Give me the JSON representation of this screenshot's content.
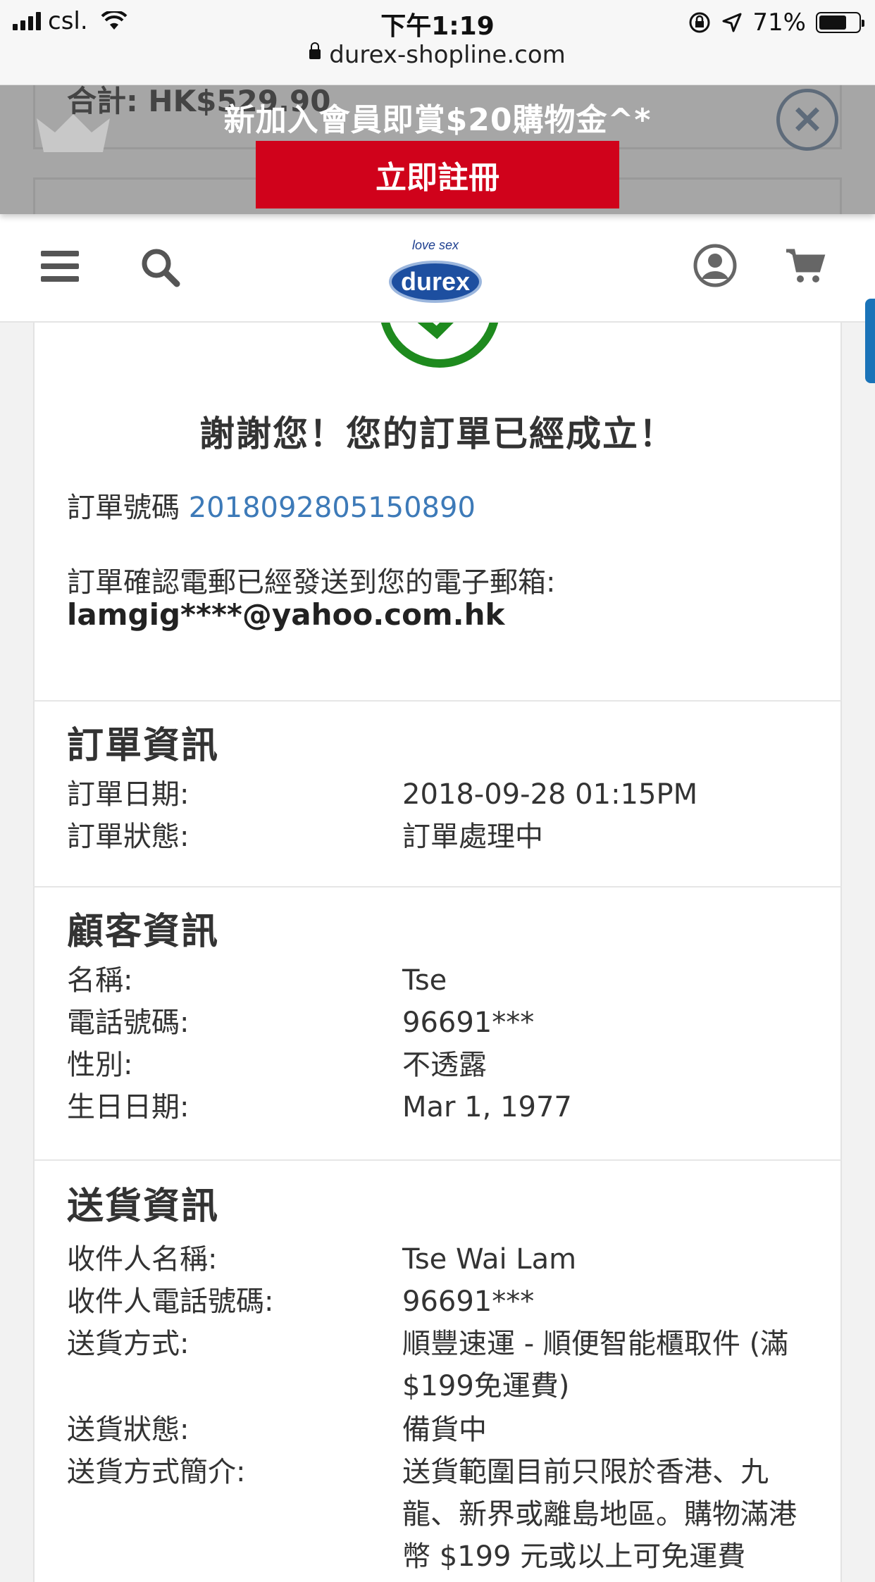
{
  "status_bar": {
    "carrier": "csl.",
    "time": "下午1:19",
    "battery_percent": "71%",
    "battery_level": 0.71,
    "url": "durex-shopline.com"
  },
  "promo": {
    "underlying_text": "合計: HK$529.90",
    "title": "新加入會員即賞$20購物金^*",
    "register_button": "立即註冊",
    "close_symbol": "✕"
  },
  "header": {
    "icons": [
      "menu-icon",
      "search-icon",
      "user-account-icon",
      "cart-icon"
    ],
    "logo_tagline": "love sex",
    "logo_brand": "durex"
  },
  "confirmation": {
    "thanks": "謝謝您！您的訂單已經成立！",
    "order_number_label": "訂單號碼",
    "order_number": "2018092805150890",
    "email_note": "訂單確認電郵已經發送到您的電子郵箱:",
    "email": "lamgig****@yahoo.com.hk"
  },
  "order_info": {
    "title": "訂單資訊",
    "rows": [
      {
        "label": "訂單日期:",
        "value": "2018-09-28 01:15PM"
      },
      {
        "label": "訂單狀態:",
        "value": "訂單處理中"
      }
    ]
  },
  "customer_info": {
    "title": "顧客資訊",
    "rows": [
      {
        "label": "名稱:",
        "value": "Tse"
      },
      {
        "label": "電話號碼:",
        "value": "96691***"
      },
      {
        "label": "性別:",
        "value": "不透露"
      },
      {
        "label": "生日日期:",
        "value": "Mar 1, 1977"
      }
    ]
  },
  "delivery_info": {
    "title": "送貨資訊",
    "rows": [
      {
        "label": "收件人名稱:",
        "value": "Tse Wai Lam"
      },
      {
        "label": "收件人電話號碼:",
        "value": "96691***"
      },
      {
        "label": "送貨方式:",
        "value": "順豐速運 - 順便智能櫃取件 (滿 $199免運費)"
      },
      {
        "label": "送貨狀態:",
        "value": "備貨中"
      },
      {
        "label": "送貨方式簡介:",
        "value": "送貨範圍目前只限於香港、九龍、新界或離島地區。購物滿港幣 $199 元或以上可免運費"
      }
    ]
  },
  "colors": {
    "promo_button": "#d0021b",
    "link_blue": "#3d7ab8",
    "check_green": "#1e8a1e"
  }
}
